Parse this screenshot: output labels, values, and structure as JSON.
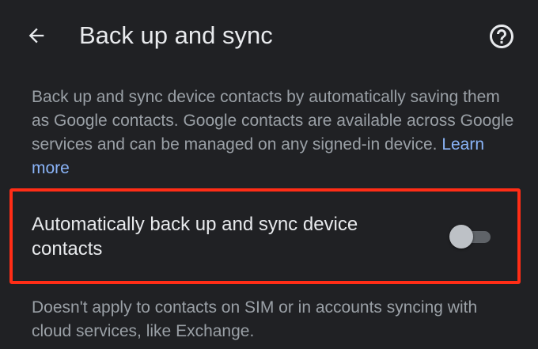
{
  "app_bar": {
    "back_icon": "arrow-back-icon",
    "title": "Back up and sync",
    "help_icon": "help-circle-icon"
  },
  "description": {
    "text": "Back up and sync device contacts by automatically saving them as Google contacts. Google contacts are available across Google services and can be managed on any signed-in device. ",
    "link_label": "Learn more"
  },
  "setting": {
    "label": "Automatically back up and sync device contacts",
    "enabled": false
  },
  "footnote": "Doesn't apply to contacts on SIM or in accounts syncing with cloud services, like Exchange.",
  "colors": {
    "background": "#202124",
    "primary_text": "#e8eaed",
    "secondary_text": "#9aa0a6",
    "link": "#8ab4f8",
    "highlight": "#ff2d16"
  }
}
